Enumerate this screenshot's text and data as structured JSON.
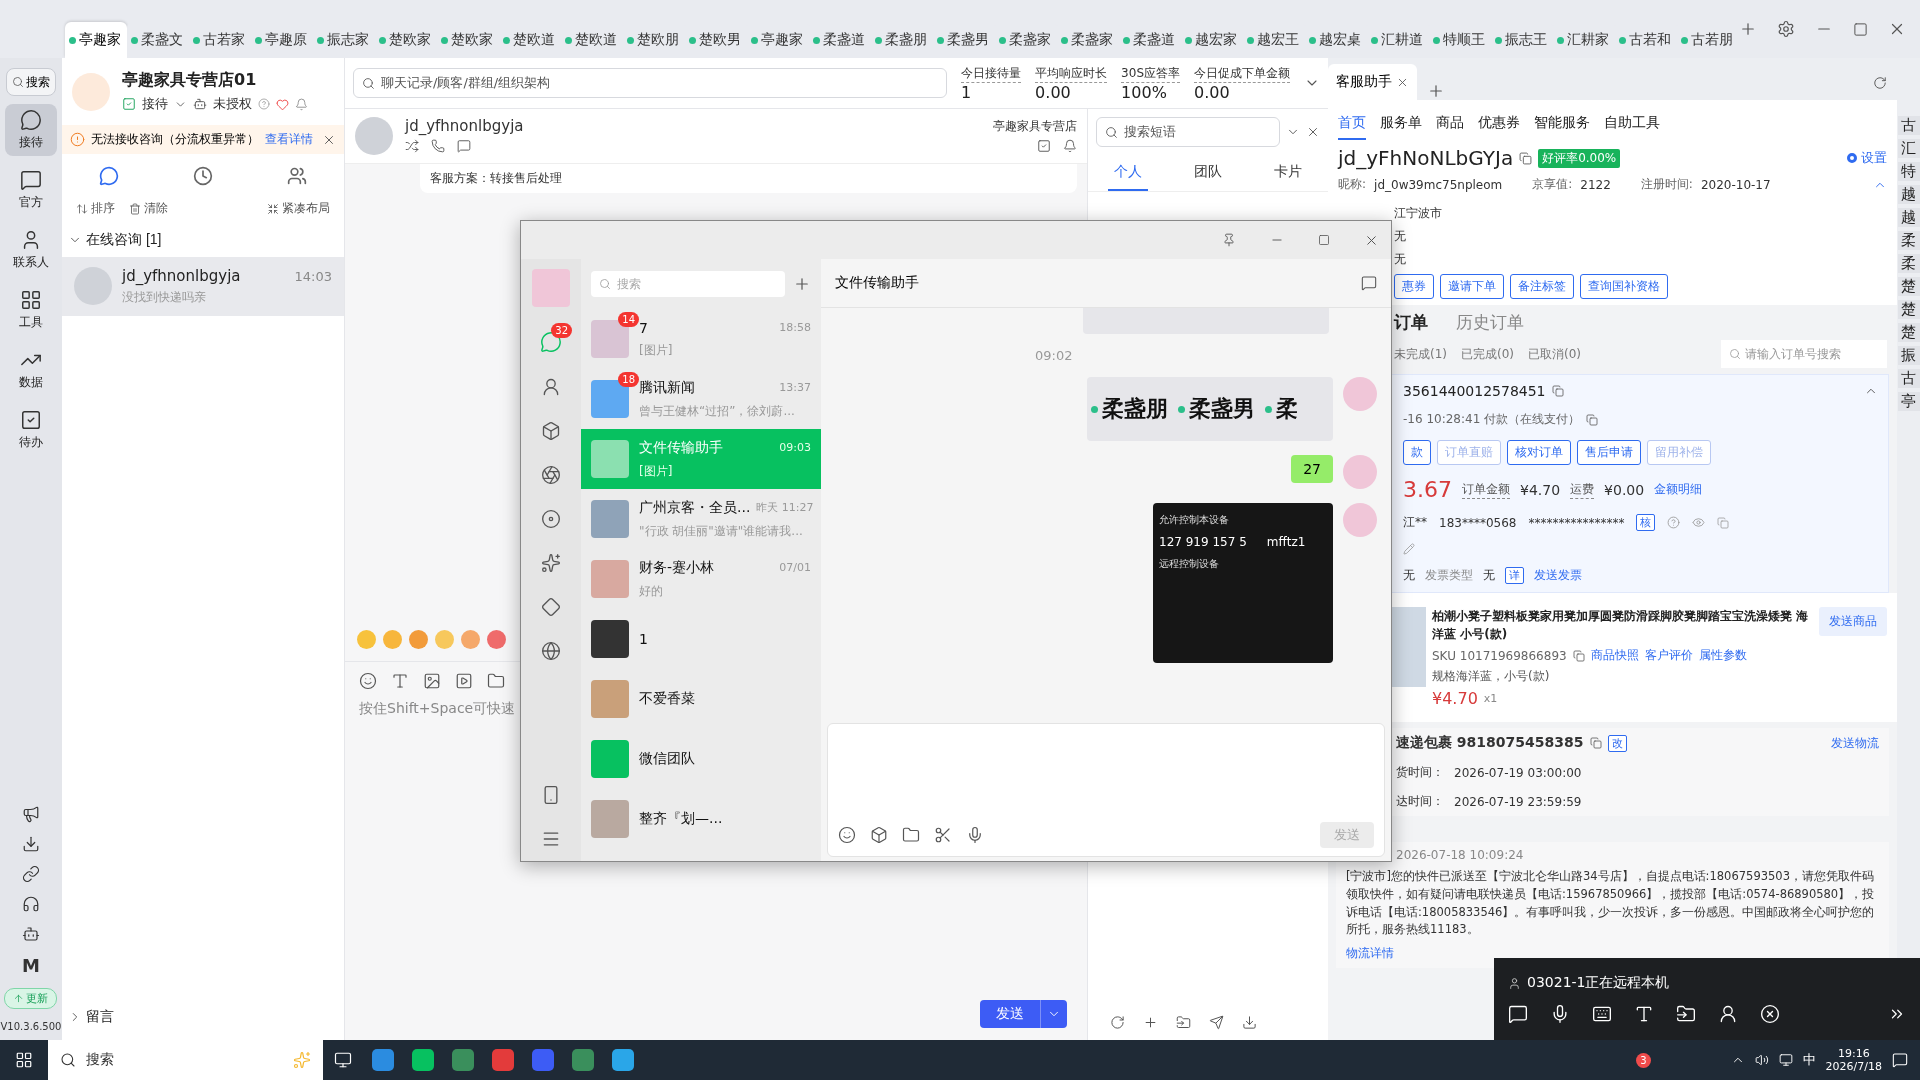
{
  "top_tabs": [
    {
      "label": "亭趣家",
      "selected": true
    },
    {
      "label": "柔盏文",
      "selected": false
    },
    {
      "label": "古若家",
      "selected": false
    },
    {
      "label": "亭趣原",
      "selected": false
    },
    {
      "label": "振志家",
      "selected": false
    },
    {
      "label": "楚欧家",
      "selected": false
    },
    {
      "label": "楚欧家",
      "selected": false
    },
    {
      "label": "楚欧道",
      "selected": false
    },
    {
      "label": "楚欧道",
      "selected": false
    },
    {
      "label": "楚欧朋",
      "selected": false
    },
    {
      "label": "楚欧男",
      "selected": false
    },
    {
      "label": "亭趣家",
      "selected": false
    },
    {
      "label": "柔盏道",
      "selected": false
    },
    {
      "label": "柔盏朋",
      "selected": false
    },
    {
      "label": "柔盏男",
      "selected": false
    },
    {
      "label": "柔盏家",
      "selected": false
    },
    {
      "label": "柔盏家",
      "selected": false
    },
    {
      "label": "柔盏道",
      "selected": false
    },
    {
      "label": "越宏家",
      "selected": false
    },
    {
      "label": "越宏王",
      "selected": false
    },
    {
      "label": "越宏桌",
      "selected": false
    },
    {
      "label": "汇耕道",
      "selected": false
    },
    {
      "label": "特顺王",
      "selected": false
    },
    {
      "label": "振志王",
      "selected": false
    },
    {
      "label": "汇耕家",
      "selected": false
    },
    {
      "label": "古若和",
      "selected": false
    },
    {
      "label": "古若朋",
      "selected": false
    }
  ],
  "rail": {
    "search": "搜索",
    "items": [
      {
        "kind": "reception",
        "label": "接待",
        "selected": true
      },
      {
        "kind": "official",
        "label": "官方",
        "selected": false
      },
      {
        "kind": "contacts",
        "label": "联系人",
        "selected": false
      },
      {
        "kind": "tools",
        "label": "工具",
        "selected": false
      },
      {
        "kind": "data",
        "label": "数据",
        "selected": false
      },
      {
        "kind": "todo",
        "label": "待办",
        "selected": false
      }
    ],
    "logo": "M",
    "update": "更新",
    "version": "V10.3.6.500"
  },
  "store": {
    "name": "亭趣家具专营店01",
    "status": "接待",
    "auth": "未授权",
    "alert": {
      "text": "无法接收咨询（分流权重异常）",
      "link": "查看详情"
    },
    "view_tabs": [
      {
        "kind": "chat",
        "selected": true
      },
      {
        "kind": "history",
        "selected": false
      },
      {
        "kind": "team",
        "selected": false
      }
    ],
    "actions": [
      "排序",
      "清除",
      "紧凑布局"
    ],
    "group": {
      "label": "在线咨询 [1]",
      "expanded": true
    },
    "conversations": [
      {
        "name": "jd_yfhnonlbgyja",
        "time": "14:03",
        "preview": "没找到快递吗亲",
        "selected": true
      }
    ],
    "footer_group": {
      "label": "留言",
      "expanded": false
    }
  },
  "chat": {
    "search_placeholder": "聊天记录/顾客/群组/组织架构",
    "stats": [
      {
        "label": "今日接待量",
        "value": "1"
      },
      {
        "label": "平均响应时长",
        "value": "0.00"
      },
      {
        "label": "30S应答率",
        "value": "100%"
      },
      {
        "label": "今日促成下单金额",
        "value": "0.00"
      }
    ],
    "customer": "jd_yfhnonlbgyja",
    "store": "亭趣家具专营店",
    "card": "客服方案：转接售后处理",
    "input_placeholder": "按住Shift+Space可快速",
    "send": "发送"
  },
  "phrases": {
    "search_placeholder": "搜索短语",
    "tabs": [
      {
        "label": "个人",
        "selected": true
      },
      {
        "label": "团队",
        "selected": false
      },
      {
        "label": "卡片",
        "selected": false
      }
    ]
  },
  "assistant": {
    "tab": "客服助手",
    "nav": [
      {
        "label": "首页",
        "selected": true
      },
      {
        "label": "服务单",
        "selected": false
      },
      {
        "label": "商品",
        "selected": false
      },
      {
        "label": "优惠券",
        "selected": false
      },
      {
        "label": "智能服务",
        "selected": false
      },
      {
        "label": "自助工具",
        "selected": false
      }
    ],
    "customer": "jd_yFhNoNLbGYJa",
    "rating": "好评率0.00%",
    "settings": {
      "label": "设置",
      "checked": true
    },
    "info": [
      {
        "label": "昵称:",
        "value": "jd_0w39mc75npleom"
      },
      {
        "label": "京享值:",
        "value": "2122"
      },
      {
        "label": "注册时间:",
        "value": "2020-10-17"
      }
    ],
    "info_lines": [
      "江宁波市",
      "无",
      "无"
    ],
    "actions": [
      "惠券",
      "邀请下单",
      "备注标签",
      "查询国补资格"
    ],
    "order_tabs": [
      {
        "label": "订单",
        "selected": true
      },
      {
        "label": "历史订单",
        "selected": false
      }
    ],
    "order_filters": [
      "未完成(1)",
      "已完成(0)",
      "已取消(0)"
    ],
    "order_search": "请输入订单号搜索",
    "order": {
      "number": "3561440012578451",
      "paid": "-16 10:28:41 付款（在线支付）",
      "buttons": [
        {
          "label": "款",
          "disabled": false
        },
        {
          "label": "订单直赔",
          "disabled": true
        },
        {
          "label": "核对订单",
          "disabled": false
        },
        {
          "label": "售后申请",
          "disabled": false
        },
        {
          "label": "留用补偿",
          "disabled": true
        }
      ],
      "paid_amount": "3.67",
      "amount_label": "订单金额",
      "amount": "¥4.70",
      "freight_label": "运费",
      "freight": "¥0.00",
      "detail_link": "金额明细",
      "receiver": "江**",
      "phone": "183****0568",
      "address": "****************",
      "verify": "核",
      "invoice": "无",
      "invoice_type_label": "发票类型",
      "invoice_type": "无",
      "invoice_detail": "详",
      "send_invoice": "发送发票"
    },
    "product": {
      "title": "柏潮小凳子塑料板凳家用凳加厚圆凳防滑踩脚胶凳脚踏宝宝洗澡矮凳 海洋蓝 小号(款)",
      "send": "发送商品",
      "sku": "SKU 10171969866893",
      "links": [
        "商品快照",
        "客户评价",
        "属性参数"
      ],
      "spec": "规格海洋蓝，小号(款)",
      "price": "¥4.70",
      "qty": "x1"
    },
    "logistics": {
      "title": "速递包裹 9818075458385",
      "edit": "改",
      "send": "发送物流",
      "times": [
        {
          "label": "货时间：",
          "value": "2026-07-19 03:00:00"
        },
        {
          "label": "达时间：",
          "value": "2026-07-19 23:59:59"
        }
      ],
      "update_time": "2026-07-18 10:09:24",
      "message": "[宁波市]您的快件已派送至【宁波北仑华山路34号店】，自提点电话:18067593503，请您凭取件码领取快件，如有疑问请电联快递员【电话:15967850966】，揽投部【电话:0574-86890580】，投诉电话【电话:18005833546】。有事呼叫我，少一次投诉，多一份感恩。中国邮政将全心呵护您的所托，服务热线11183。",
      "detail_link": "物流详情"
    }
  },
  "side_tabs": [
    "古",
    "汇",
    "特",
    "越",
    "越",
    "柔",
    "柔",
    "楚",
    "楚",
    "楚",
    "振",
    "古",
    "亭"
  ],
  "wechat": {
    "search_placeholder": "搜索",
    "chat_badge": "32",
    "chats": [
      {
        "name": "7",
        "time": "18:58",
        "preview": "[图片]",
        "badge": "14",
        "selected": false
      },
      {
        "name": "腾讯新闻",
        "time": "13:37",
        "preview": "曾与王健林“过招”，徐刘蔚...",
        "badge": "18",
        "selected": false
      },
      {
        "name": "文件传输助手",
        "time": "09:03",
        "preview": "[图片]",
        "selected": true
      },
      {
        "name": "广州京客・全员...",
        "time": "昨天 11:27",
        "preview": "\"行政 胡佳丽\"邀请\"谁能请我...",
        "selected": false
      },
      {
        "name": "财务-蹇小林",
        "time": "07/01",
        "preview": "好的",
        "selected": false
      },
      {
        "name": "1",
        "selected": false
      },
      {
        "name": "不爱香菜",
        "selected": false
      },
      {
        "name": "微信团队",
        "selected": false
      },
      {
        "name": "整齐『划—...",
        "selected": false
      }
    ],
    "title": "文件传输助手",
    "messages": [
      {
        "kind": "image_top"
      },
      {
        "kind": "time",
        "text": "09:02"
      },
      {
        "kind": "tabs_image",
        "labels": [
          "柔盏朋",
          "柔盏男",
          "柔"
        ]
      },
      {
        "kind": "text",
        "text": "27"
      },
      {
        "kind": "remote_image",
        "title": "允许控制本设备",
        "code": "127 919 157 5",
        "password": "mfftz1",
        "subtitle": "远程控制设备"
      }
    ],
    "send": "发送"
  },
  "remote_toast": {
    "text": "03021-1正在远程本机"
  },
  "taskbar": {
    "search": "搜索",
    "badge": "3",
    "ime": "中",
    "time": "19:16",
    "date": "2026/7/18"
  }
}
